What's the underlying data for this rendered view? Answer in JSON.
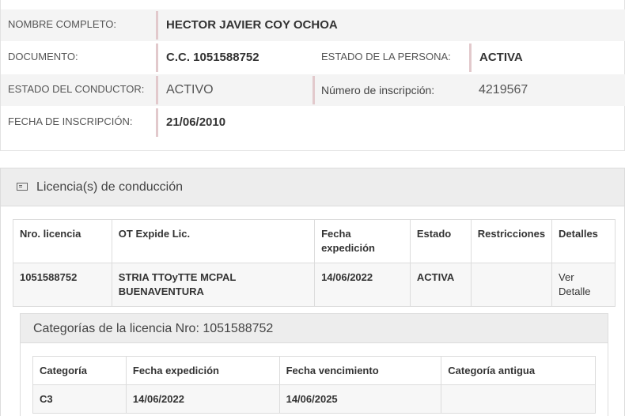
{
  "persona": {
    "nombre_label": "NOMBRE COMPLETO:",
    "nombre_value": "HECTOR JAVIER COY OCHOA",
    "documento_label": "DOCUMENTO:",
    "documento_value": "C.C. 1051588752",
    "estado_persona_label": "ESTADO DE LA PERSONA:",
    "estado_persona_value": "ACTIVA",
    "estado_conductor_label": "ESTADO DEL CONDUCTOR:",
    "estado_conductor_value": "ACTIVO",
    "inscripcion_num_label": "Número de inscripción:",
    "inscripcion_num_value": "4219567",
    "fecha_inscripcion_label": "FECHA DE INSCRIPCIÓN:",
    "fecha_inscripcion_value": "21/06/2010"
  },
  "licencias_panel": {
    "title": "Licencia(s) de conducción",
    "icon": "id-card-icon",
    "columns": [
      "Nro. licencia",
      "OT Expide Lic.",
      "Fecha expedición",
      "Estado",
      "Restricciones",
      "Detalles"
    ],
    "rows": [
      {
        "nro": "1051588752",
        "ot": "STRIA TTOyTTE MCPAL BUENAVENTURA",
        "fecha": "14/06/2022",
        "estado": "ACTIVA",
        "restricciones": "",
        "detalles": "Ver Detalle"
      }
    ]
  },
  "categorias_panel": {
    "title": "Categorías de la licencia Nro: 1051588752",
    "columns": [
      "Categoría",
      "Fecha expedición",
      "Fecha vencimiento",
      "Categoría antigua"
    ],
    "rows": [
      {
        "categoria": "C3",
        "fecha_expedicion": "14/06/2022",
        "fecha_vencimiento": "14/06/2025",
        "categoria_antigua": ""
      }
    ]
  }
}
